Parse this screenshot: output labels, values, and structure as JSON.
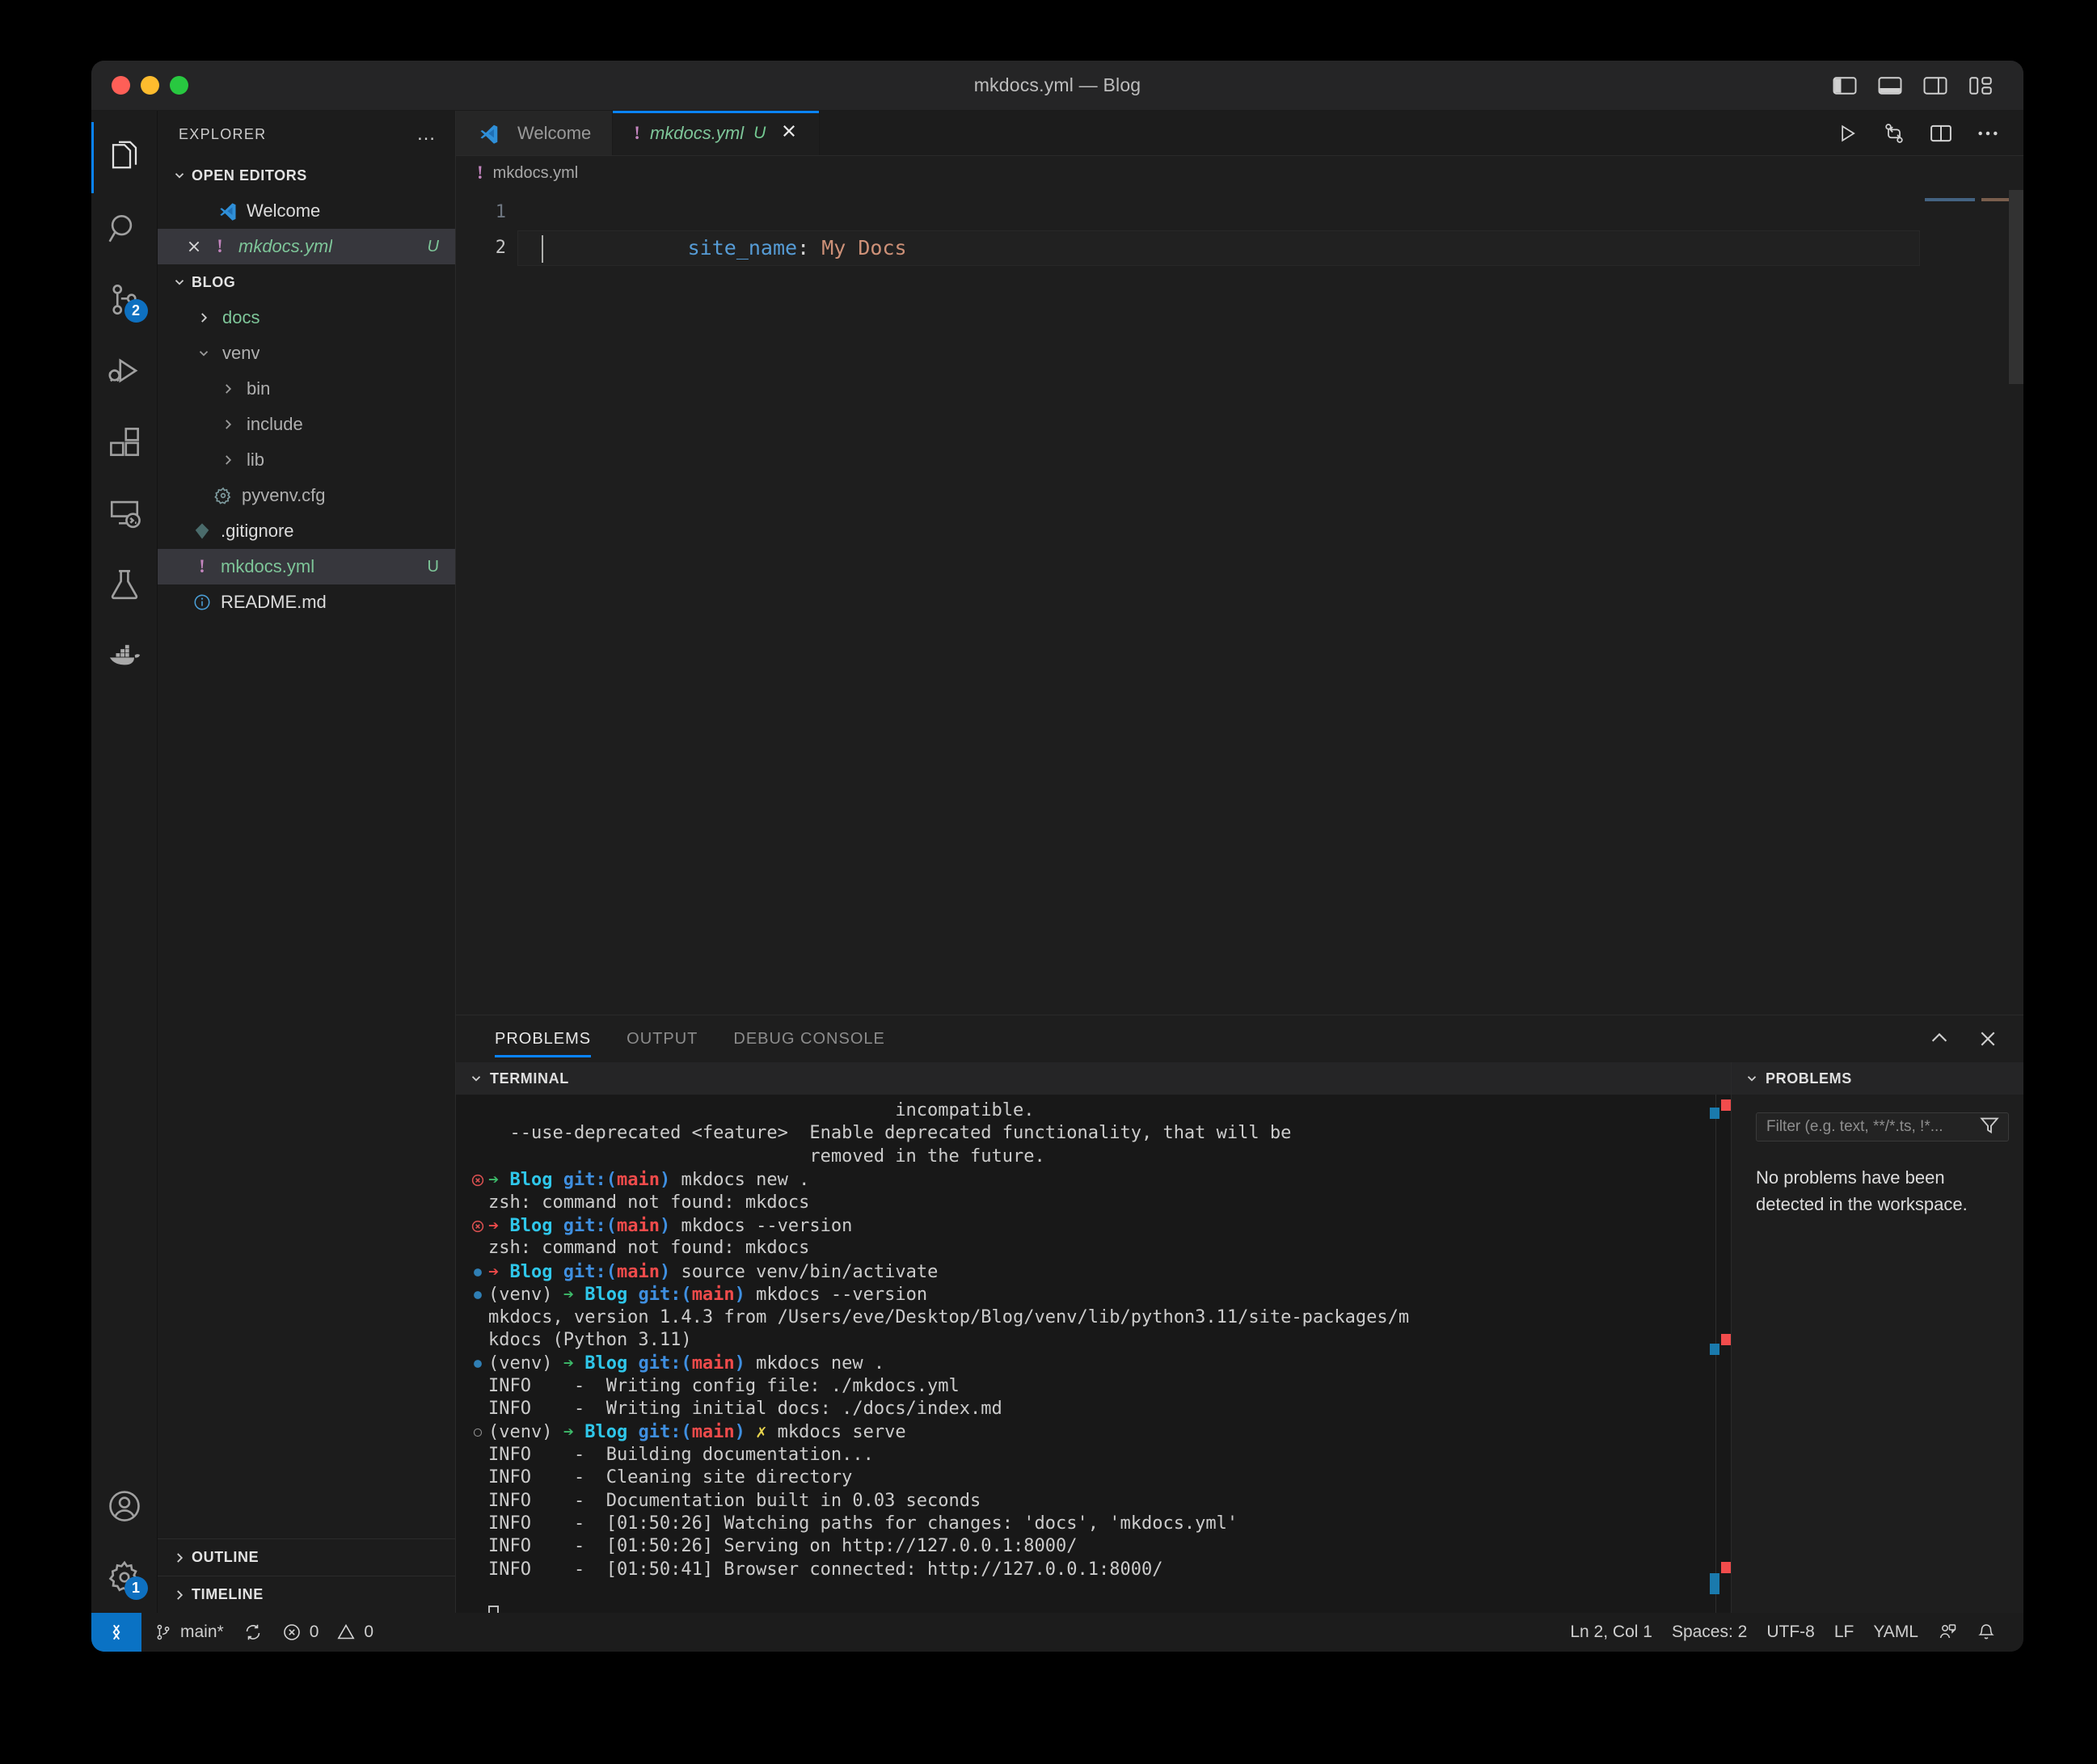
{
  "window": {
    "title": "mkdocs.yml — Blog",
    "traffic_lights": [
      "close",
      "minimize",
      "zoom"
    ],
    "layout_toggles": [
      {
        "name": "toggle-primary-sidebar",
        "label": "Toggle Primary Side Bar"
      },
      {
        "name": "toggle-panel",
        "label": "Toggle Panel"
      },
      {
        "name": "toggle-secondary-sidebar",
        "label": "Toggle Secondary Side Bar"
      },
      {
        "name": "customize-layout",
        "label": "Customize Layout"
      }
    ]
  },
  "activity_bar": {
    "items": [
      {
        "name": "explorer",
        "icon": "files-icon",
        "active": true,
        "badge": ""
      },
      {
        "name": "search",
        "icon": "search-icon",
        "active": false,
        "badge": ""
      },
      {
        "name": "source-control",
        "icon": "source-control-icon",
        "active": false,
        "badge": "2"
      },
      {
        "name": "run-and-debug",
        "icon": "run-debug-icon",
        "active": false,
        "badge": ""
      },
      {
        "name": "extensions",
        "icon": "extensions-icon",
        "active": false,
        "badge": ""
      },
      {
        "name": "remote-explorer",
        "icon": "remote-explorer-icon",
        "active": false,
        "badge": ""
      },
      {
        "name": "testing",
        "icon": "beaker-icon",
        "active": false,
        "badge": ""
      },
      {
        "name": "docker",
        "icon": "docker-whale-icon",
        "active": false,
        "badge": ""
      }
    ],
    "bottom_items": [
      {
        "name": "accounts",
        "icon": "account-icon",
        "badge": ""
      },
      {
        "name": "manage",
        "icon": "gear-icon",
        "badge": "1"
      }
    ]
  },
  "sidebar": {
    "title": "EXPLORER",
    "more_actions": "…",
    "open_editors": {
      "label": "OPEN EDITORS",
      "expanded": true,
      "items": [
        {
          "name": "Welcome",
          "icon": "vscode-logo-icon",
          "suffix": "",
          "selected": false,
          "closable": false,
          "style": "plain"
        },
        {
          "name": "mkdocs.yml",
          "icon": "yaml-warning-icon",
          "suffix": "U",
          "selected": true,
          "closable": true,
          "style": "untracked-italic"
        }
      ]
    },
    "project": {
      "label": "BLOG",
      "expanded": true,
      "items": [
        {
          "name": "docs",
          "kind": "folder",
          "expanded": false,
          "depth": 1,
          "style": "untracked",
          "decoration": "green-dot"
        },
        {
          "name": "venv",
          "kind": "folder",
          "expanded": true,
          "depth": 1,
          "style": "ignored",
          "decoration": ""
        },
        {
          "name": "bin",
          "kind": "folder",
          "expanded": false,
          "depth": 2,
          "style": "ignored",
          "decoration": ""
        },
        {
          "name": "include",
          "kind": "folder",
          "expanded": false,
          "depth": 2,
          "style": "ignored",
          "decoration": ""
        },
        {
          "name": "lib",
          "kind": "folder",
          "expanded": false,
          "depth": 2,
          "style": "ignored",
          "decoration": ""
        },
        {
          "name": "pyvenv.cfg",
          "kind": "file",
          "icon": "gear-file-icon",
          "depth": 2,
          "style": "ignored",
          "decoration": ""
        },
        {
          "name": ".gitignore",
          "kind": "file",
          "icon": "git-icon",
          "depth": 1,
          "style": "plain",
          "decoration": ""
        },
        {
          "name": "mkdocs.yml",
          "kind": "file",
          "icon": "yaml-warning-icon",
          "depth": 1,
          "style": "untracked",
          "decoration": "U",
          "selected": true
        },
        {
          "name": "README.md",
          "kind": "file",
          "icon": "info-icon",
          "depth": 1,
          "style": "plain",
          "decoration": ""
        }
      ]
    },
    "bottom_sections": [
      {
        "label": "OUTLINE",
        "expanded": false
      },
      {
        "label": "TIMELINE",
        "expanded": false
      }
    ]
  },
  "editor": {
    "tabs": [
      {
        "label": "Welcome",
        "icon": "vscode-logo-icon",
        "active": false,
        "dirty": "",
        "closable": false
      },
      {
        "label": "mkdocs.yml",
        "icon": "yaml-warning-icon",
        "active": true,
        "dirty": "U",
        "closable": true
      }
    ],
    "actions": [
      {
        "name": "run-file-button",
        "icon": "play-icon"
      },
      {
        "name": "open-changes-button",
        "icon": "compare-changes-icon"
      },
      {
        "name": "split-editor-button",
        "icon": "split-editor-icon"
      },
      {
        "name": "more-actions-button",
        "icon": "ellipsis-icon"
      }
    ],
    "breadcrumb": {
      "icon": "yaml-warning-icon",
      "text": "mkdocs.yml"
    },
    "lines": [
      {
        "number": "1",
        "tokens": [
          {
            "text": "site_name",
            "cls": "k-key"
          },
          {
            "text": ": ",
            "cls": "k-punc"
          },
          {
            "text": "My Docs",
            "cls": "k-val"
          }
        ]
      },
      {
        "number": "2",
        "tokens": []
      }
    ],
    "cursor_line": 2
  },
  "panel": {
    "tabs": [
      {
        "label": "PROBLEMS",
        "active": true
      },
      {
        "label": "OUTPUT",
        "active": false
      },
      {
        "label": "DEBUG CONSOLE",
        "active": false
      }
    ],
    "actions": [
      {
        "name": "collapse-panel-button",
        "icon": "chevron-up-icon"
      },
      {
        "name": "close-panel-button",
        "icon": "close-icon"
      }
    ],
    "terminal": {
      "header": "TERMINAL",
      "lines": [
        {
          "deco": "",
          "segs": [
            {
              "t": "                                      incompatible.",
              "c": "c-grey"
            }
          ]
        },
        {
          "deco": "",
          "segs": [
            {
              "t": "  --use-deprecated <feature>  Enable deprecated functionality, that will be",
              "c": "c-grey"
            }
          ]
        },
        {
          "deco": "",
          "segs": [
            {
              "t": "                              removed in the future.",
              "c": "c-grey"
            }
          ]
        },
        {
          "deco": "error",
          "segs": [
            {
              "t": "➔ ",
              "c": "c-green"
            },
            {
              "t": "Blog ",
              "c": "c-cyanb"
            },
            {
              "t": "git:(",
              "c": "c-blueb"
            },
            {
              "t": "main",
              "c": "c-red"
            },
            {
              "t": ") ",
              "c": "c-blueb"
            },
            {
              "t": "mkdocs new .",
              "c": "c-grey"
            }
          ]
        },
        {
          "deco": "",
          "segs": [
            {
              "t": "zsh: command not found: mkdocs",
              "c": "c-grey"
            }
          ]
        },
        {
          "deco": "error",
          "segs": [
            {
              "t": "➔ ",
              "c": "c-red"
            },
            {
              "t": "Blog ",
              "c": "c-cyanb"
            },
            {
              "t": "git:(",
              "c": "c-blueb"
            },
            {
              "t": "main",
              "c": "c-red"
            },
            {
              "t": ") ",
              "c": "c-blueb"
            },
            {
              "t": "mkdocs --version",
              "c": "c-grey"
            }
          ]
        },
        {
          "deco": "",
          "segs": [
            {
              "t": "zsh: command not found: mkdocs",
              "c": "c-grey"
            }
          ]
        },
        {
          "deco": "ok",
          "segs": [
            {
              "t": "➔ ",
              "c": "c-red"
            },
            {
              "t": "Blog ",
              "c": "c-cyanb"
            },
            {
              "t": "git:(",
              "c": "c-blueb"
            },
            {
              "t": "main",
              "c": "c-red"
            },
            {
              "t": ") ",
              "c": "c-blueb"
            },
            {
              "t": "source venv/bin/activate",
              "c": "c-grey"
            }
          ]
        },
        {
          "deco": "ok",
          "segs": [
            {
              "t": "(venv) ",
              "c": "c-grey"
            },
            {
              "t": "➔ ",
              "c": "c-green"
            },
            {
              "t": "Blog ",
              "c": "c-cyanb"
            },
            {
              "t": "git:(",
              "c": "c-blueb"
            },
            {
              "t": "main",
              "c": "c-red"
            },
            {
              "t": ") ",
              "c": "c-blueb"
            },
            {
              "t": "mkdocs --version",
              "c": "c-grey"
            }
          ]
        },
        {
          "deco": "",
          "segs": [
            {
              "t": "mkdocs, version 1.4.3 from /Users/eve/Desktop/Blog/venv/lib/python3.11/site-packages/m",
              "c": "c-grey"
            }
          ]
        },
        {
          "deco": "",
          "segs": [
            {
              "t": "kdocs (Python 3.11)",
              "c": "c-grey"
            }
          ]
        },
        {
          "deco": "ok",
          "segs": [
            {
              "t": "(venv) ",
              "c": "c-grey"
            },
            {
              "t": "➔ ",
              "c": "c-green"
            },
            {
              "t": "Blog ",
              "c": "c-cyanb"
            },
            {
              "t": "git:(",
              "c": "c-blueb"
            },
            {
              "t": "main",
              "c": "c-red"
            },
            {
              "t": ") ",
              "c": "c-blueb"
            },
            {
              "t": "mkdocs new .",
              "c": "c-grey"
            }
          ]
        },
        {
          "deco": "",
          "segs": [
            {
              "t": "INFO    -  Writing config file: ./mkdocs.yml",
              "c": "c-grey"
            }
          ]
        },
        {
          "deco": "",
          "segs": [
            {
              "t": "INFO    -  Writing initial docs: ./docs/index.md",
              "c": "c-grey"
            }
          ]
        },
        {
          "deco": "running",
          "segs": [
            {
              "t": "(venv) ",
              "c": "c-grey"
            },
            {
              "t": "➔ ",
              "c": "c-green"
            },
            {
              "t": "Blog ",
              "c": "c-cyanb"
            },
            {
              "t": "git:(",
              "c": "c-blueb"
            },
            {
              "t": "main",
              "c": "c-red"
            },
            {
              "t": ") ",
              "c": "c-blueb"
            },
            {
              "t": "✗ ",
              "c": "c-yellow"
            },
            {
              "t": "mkdocs serve",
              "c": "c-grey"
            }
          ]
        },
        {
          "deco": "",
          "segs": [
            {
              "t": "INFO    -  Building documentation...",
              "c": "c-grey"
            }
          ]
        },
        {
          "deco": "",
          "segs": [
            {
              "t": "INFO    -  Cleaning site directory",
              "c": "c-grey"
            }
          ]
        },
        {
          "deco": "",
          "segs": [
            {
              "t": "INFO    -  Documentation built in 0.03 seconds",
              "c": "c-grey"
            }
          ]
        },
        {
          "deco": "",
          "segs": [
            {
              "t": "INFO    -  [01:50:26] Watching paths for changes: 'docs', 'mkdocs.yml'",
              "c": "c-grey"
            }
          ]
        },
        {
          "deco": "",
          "segs": [
            {
              "t": "INFO    -  [01:50:26] Serving on http://127.0.0.1:8000/",
              "c": "c-grey"
            }
          ]
        },
        {
          "deco": "",
          "segs": [
            {
              "t": "INFO    -  [01:50:41] Browser connected: http://127.0.0.1:8000/",
              "c": "c-grey"
            }
          ]
        },
        {
          "deco": "",
          "segs": []
        },
        {
          "deco": "",
          "segs": [
            {
              "t": "",
              "c": "c-grey",
              "cursor": true
            }
          ]
        }
      ]
    },
    "problems": {
      "header": "PROBLEMS",
      "filter_placeholder": "Filter (e.g. text, **/*.ts, !*...",
      "filter_value": "",
      "filter_icon": "filter-icon",
      "empty_message": "No problems have been detected in the workspace."
    }
  },
  "status_bar": {
    "remote_icon": "remote-window-icon",
    "left": [
      {
        "name": "branch",
        "icon": "git-branch-icon",
        "label": "main*"
      },
      {
        "name": "sync",
        "icon": "sync-icon",
        "label": ""
      },
      {
        "name": "errors",
        "icon": "error-circle-icon",
        "label": "0"
      },
      {
        "name": "warnings",
        "icon": "warning-triangle-icon",
        "label": "0"
      }
    ],
    "right": [
      {
        "name": "cursor-position",
        "label": "Ln 2, Col 1"
      },
      {
        "name": "indentation",
        "label": "Spaces: 2"
      },
      {
        "name": "encoding",
        "label": "UTF-8"
      },
      {
        "name": "eol",
        "label": "LF"
      },
      {
        "name": "language-mode",
        "label": "YAML"
      },
      {
        "name": "live-share",
        "icon": "live-share-icon",
        "label": ""
      },
      {
        "name": "notifications",
        "icon": "bell-icon",
        "label": ""
      }
    ]
  }
}
